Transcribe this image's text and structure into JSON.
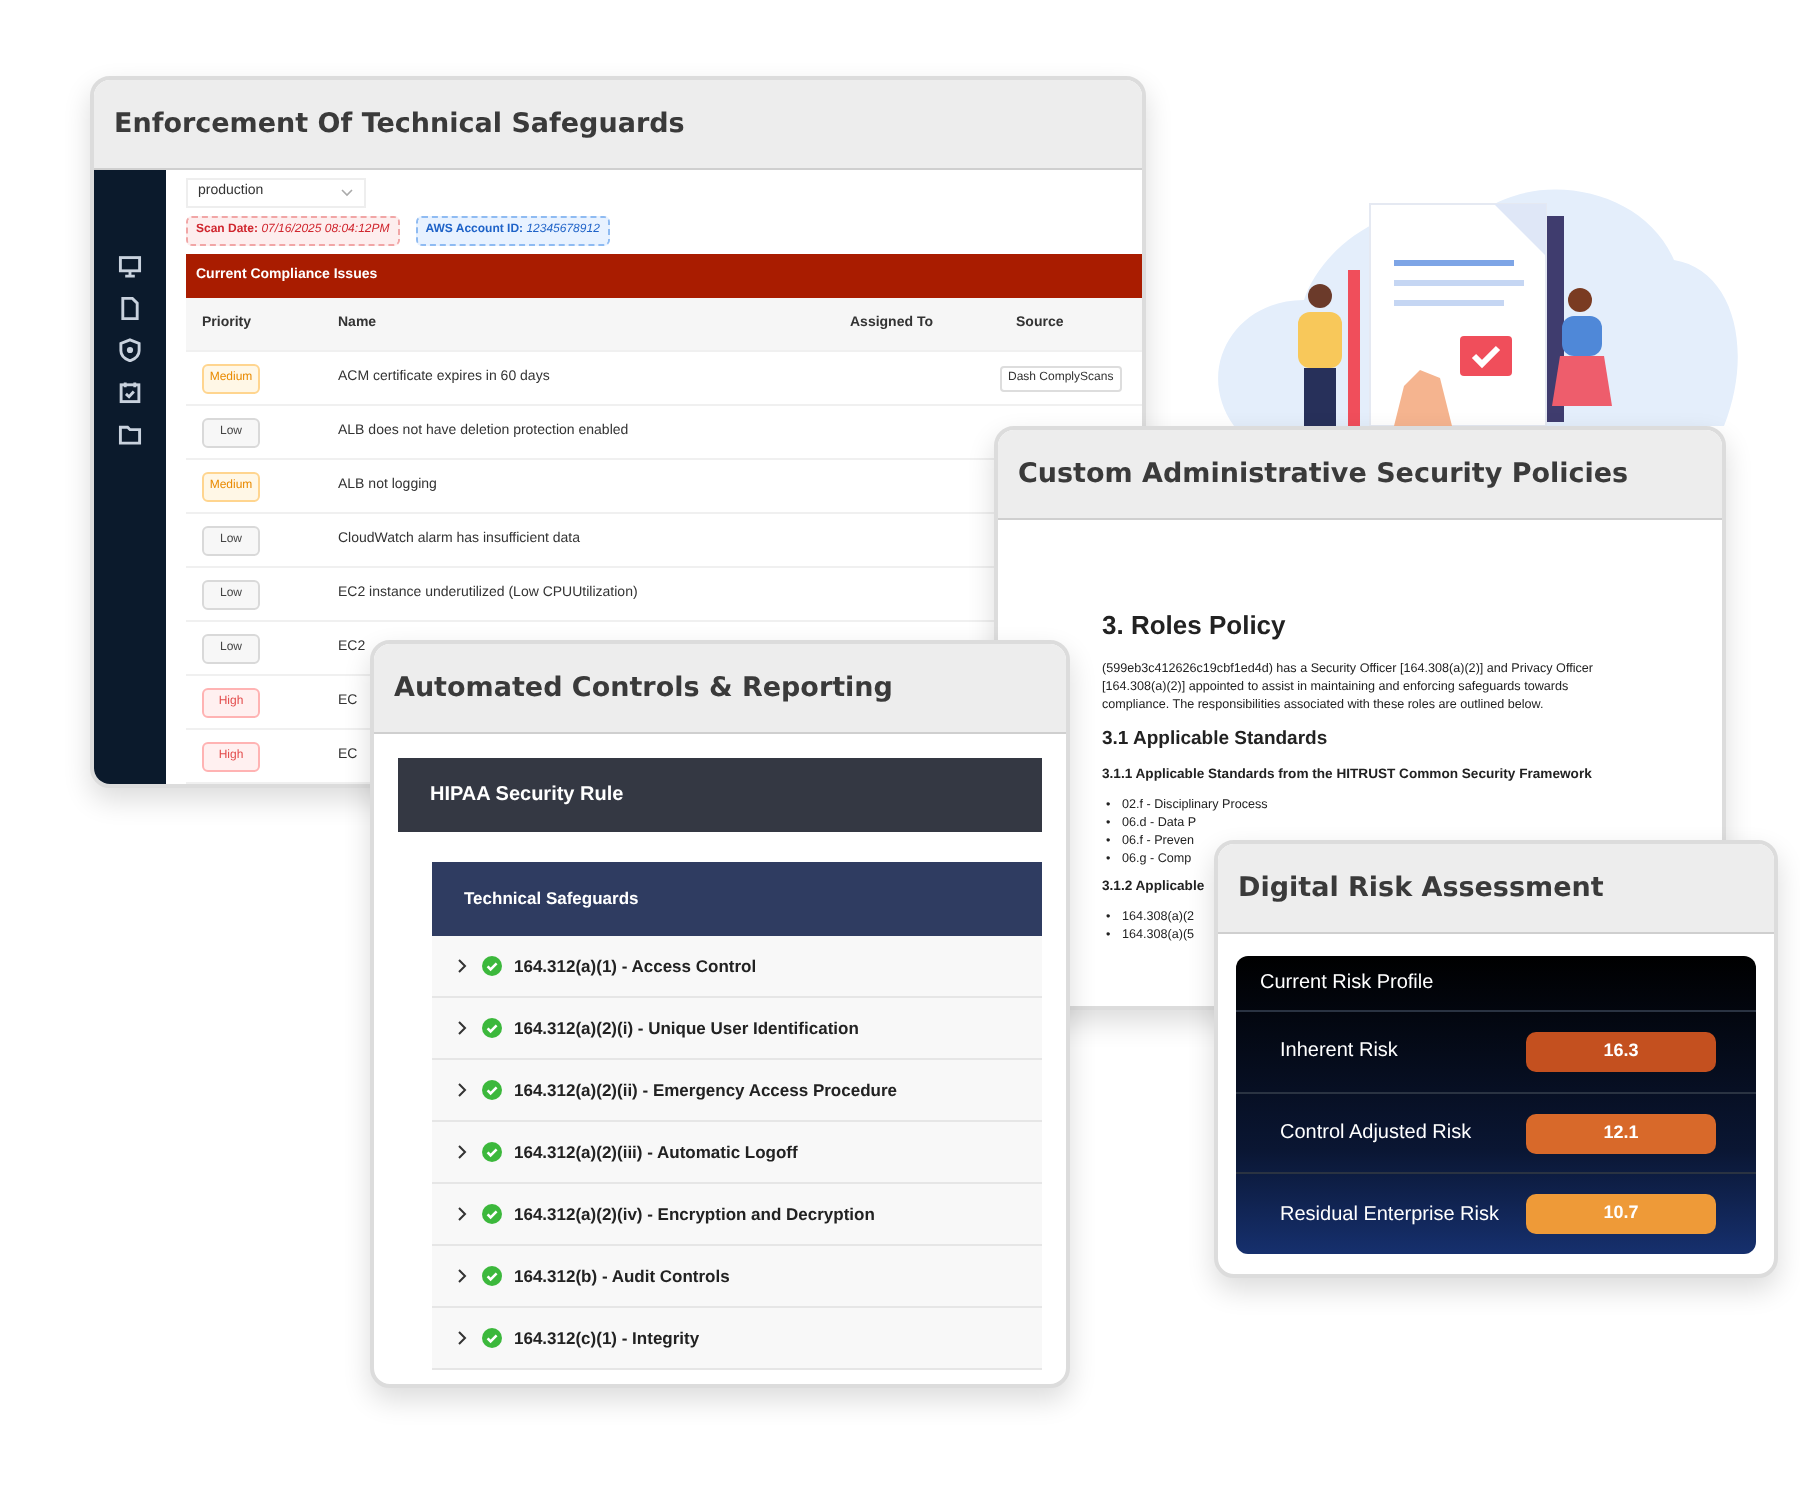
{
  "enforcement_card": {
    "title": "Enforcement Of Technical Safeguards",
    "environment_select": {
      "value": "production"
    },
    "scan_date": {
      "label": "Scan Date:",
      "value": "07/16/2025 08:04:12PM"
    },
    "account_id": {
      "label": "AWS Account ID:",
      "value": "12345678912"
    },
    "issues_panel": {
      "title": "Current Compliance Issues",
      "columns": [
        "Priority",
        "Name",
        "Assigned To",
        "Source"
      ],
      "rows": [
        {
          "priority": "Medium",
          "kind": "medium",
          "name": "ACM certificate expires in 60 days",
          "source": "Dash ComplyScans"
        },
        {
          "priority": "Low",
          "kind": "low",
          "name": "ALB does not have deletion protection enabled"
        },
        {
          "priority": "Medium",
          "kind": "medium",
          "name": "ALB not logging"
        },
        {
          "priority": "Low",
          "kind": "low",
          "name": "CloudWatch alarm has insufficient data"
        },
        {
          "priority": "Low",
          "kind": "low",
          "name": "EC2 instance underutilized (Low CPUUtilization)"
        },
        {
          "priority": "Low",
          "kind": "low",
          "name": "EC2"
        },
        {
          "priority": "High",
          "kind": "high",
          "name": "EC"
        },
        {
          "priority": "High",
          "kind": "high",
          "name": "EC"
        }
      ]
    }
  },
  "policies_card": {
    "title": "Custom Administrative Security Policies",
    "blocks": [
      {
        "kind": "h1",
        "text": "3. Roles Policy"
      },
      {
        "kind": "p",
        "text": "(599eb3c412626c19cbf1ed4d) has a Security Officer [164.308(a)(2)] and Privacy Officer [164.308(a)(2)] appointed to assist in maintaining and enforcing safeguards towards compliance. The responsibilities associated with these roles are outlined below."
      },
      {
        "kind": "h2",
        "text": "3.1 Applicable Standards"
      },
      {
        "kind": "h3",
        "text": "3.1.1 Applicable Standards from the HITRUST Common Security Framework"
      },
      {
        "kind": "list",
        "marker": "•",
        "items": [
          "02.f - Disciplinary Process",
          "06.d - Data P",
          "06.f - Preven",
          "06.g - Comp"
        ]
      },
      {
        "kind": "h3",
        "text": "3.1.2 Applicable"
      },
      {
        "kind": "list",
        "marker": "•",
        "items": [
          "164.308(a)(2",
          "164.308(a)(5"
        ]
      }
    ]
  },
  "controls_card": {
    "title": "Automated Controls & Reporting",
    "panel_title": "HIPAA Security Rule",
    "section_title": "Technical Safeguards",
    "items": [
      {
        "label": "164.312(a)(1) - Access Control",
        "expanded": false,
        "passed": true
      },
      {
        "label": "164.312(a)(2)(i) - Unique User Identification",
        "expanded": false,
        "passed": true
      },
      {
        "label": "164.312(a)(2)(ii) - Emergency Access Procedure",
        "expanded": false,
        "passed": true
      },
      {
        "label": "164.312(a)(2)(iii) - Automatic Logoff",
        "expanded": false,
        "passed": true
      },
      {
        "label": "164.312(a)(2)(iv) - Encryption and Decryption",
        "expanded": false,
        "passed": true
      },
      {
        "label": "164.312(b) - Audit Controls",
        "expanded": false,
        "passed": true
      },
      {
        "label": "164.312(c)(1) - Integrity",
        "expanded": false,
        "passed": true
      }
    ]
  },
  "risk_card": {
    "title": "Digital Risk Assessment",
    "panel_title": "Current Risk Profile",
    "rows": [
      {
        "label": "Inherent Risk",
        "value": "16.3",
        "color": "#c4501f"
      },
      {
        "label": "Control Adjusted Risk",
        "value": "12.1",
        "color": "#d8692a"
      },
      {
        "label": "Residual Enterprise Risk",
        "value": "10.7",
        "color": "#ee9a38"
      }
    ]
  }
}
